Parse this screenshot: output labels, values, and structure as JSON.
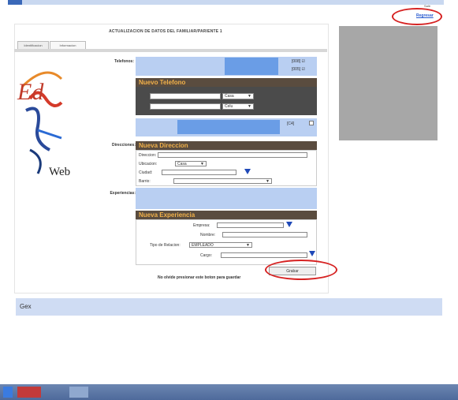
{
  "top": {
    "link_label": "Regresar",
    "small_text": "Salir"
  },
  "panel": {
    "title": "ACTUALIZACION DE DATOS DEL FAMILIAR/PARIENTE 1",
    "tabs": [
      "Identificacion",
      "Informacion"
    ]
  },
  "logo": {
    "letters": "Ed",
    "text": "Web"
  },
  "form": {
    "telefonos": {
      "label": "Telefonos:",
      "right_items": [
        "[008] ☑",
        "[005] ☑"
      ],
      "section_title": "Nuevo Telefono",
      "row1_select": "Casa",
      "row2_select": "Celu",
      "extra_item": "[C4]"
    },
    "direcciones": {
      "label": "Direcciones:",
      "section_title": "Nueva Direccion",
      "fields": {
        "direccion_label": "Direccion:",
        "ubicacion_label": "Ubicacion:",
        "ubicacion_value": "Casa",
        "ciudad_label": "Ciudad:",
        "barrio_label": "Barrio:"
      }
    },
    "experiencias": {
      "label": "Experiencias:",
      "section_title": "Nueva Experiencia",
      "fields": {
        "empresa_label": "Empresa:",
        "nombre_label": "Nombre:",
        "tipo_label": "Tipo de Relacion:",
        "tipo_value": "EMPLEADO",
        "cargo_label": "Cargo:"
      }
    },
    "guardar_label": "Grabar",
    "notice": "No olvide presionar este boton para guardar"
  },
  "bottom": {
    "icon_text": "Gex"
  },
  "colors": {
    "accent_blue": "#b9cff2",
    "section_brown": "#5a4c3f",
    "section_text": "#f1b14a",
    "highlight_red": "#d62222",
    "link_blue": "#2a5bd0"
  }
}
